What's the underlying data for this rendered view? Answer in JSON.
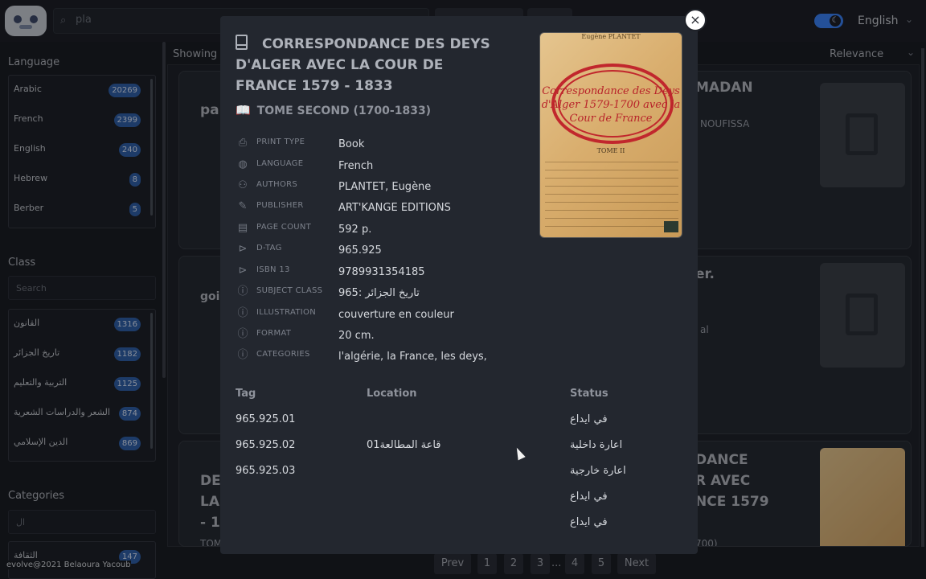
{
  "topbar": {
    "search_value": "pla",
    "language": "English"
  },
  "sidebar": {
    "language_title": "Language",
    "languages": [
      {
        "label": "Arabic",
        "count": "20269"
      },
      {
        "label": "French",
        "count": "2399"
      },
      {
        "label": "English",
        "count": "240"
      },
      {
        "label": "Hebrew",
        "count": "8"
      },
      {
        "label": "Berber",
        "count": "5"
      }
    ],
    "class_title": "Class",
    "class_search_placeholder": "Search",
    "classes": [
      {
        "label": "القانون",
        "count": "1316"
      },
      {
        "label": "تاريخ الجزائر",
        "count": "1182"
      },
      {
        "label": "التربية والتعليم",
        "count": "1125"
      },
      {
        "label": "الشعر والدراسات الشعرية",
        "count": "874"
      },
      {
        "label": "الدين الإسلامي",
        "count": "869"
      }
    ],
    "categories_title": "Categories",
    "categories_search_value": "ال",
    "categories": [
      {
        "label": "الثقافة",
        "count": "147"
      }
    ]
  },
  "footer": "evolve@2021 Belaoura Yacoub",
  "main": {
    "showing": "Showing",
    "sort": "Relevance",
    "cards": [
      {
        "title_fragment": "pa",
        "side_title": "MADAN",
        "side_sub": "NOUFISSA"
      },
      {
        "title_fragment": "goi",
        "side_title": "er.",
        "side_sub": "al"
      },
      {
        "title_fragment": "DE\nLA\n- 18",
        "side_title": "DANCE\nR AVEC\nNCE 1579",
        "side_sub": "700)",
        "sub_fragment": "TOM"
      }
    ]
  },
  "pager": {
    "prev": "Prev",
    "pages": [
      "1",
      "2",
      "3",
      "4",
      "5"
    ],
    "ellipsis": "...",
    "next": "Next"
  },
  "modal": {
    "title": "CORRESPONDANCE DES DEYS D'ALGER AVEC LA COUR DE FRANCE 1579 - 1833",
    "subtitle": "TOME SECOND (1700-1833)",
    "properties": [
      {
        "icon": "printer-icon",
        "label": "PRINT TYPE",
        "value": "Book"
      },
      {
        "icon": "globe-icon",
        "label": "LANGUAGE",
        "value": "French"
      },
      {
        "icon": "users-icon",
        "label": "AUTHORS",
        "value": "PLANTET, Eugène"
      },
      {
        "icon": "feather-icon",
        "label": "PUBLISHER",
        "value": "ART'KANGE EDITIONS"
      },
      {
        "icon": "document-icon",
        "label": "PAGE COUNT",
        "value": "592 p."
      },
      {
        "icon": "tag-icon",
        "label": "D-TAG",
        "value": "965.925"
      },
      {
        "icon": "tag-icon",
        "label": "ISBN 13",
        "value": "9789931354185"
      },
      {
        "icon": "info-icon",
        "label": "SUBJECT CLASS",
        "value": "965: تاريخ الجزائر"
      },
      {
        "icon": "info-icon",
        "label": "ILLUSTRATION",
        "value": "couverture en couleur"
      },
      {
        "icon": "info-icon",
        "label": "FORMAT",
        "value": "20 cm."
      },
      {
        "icon": "info-icon",
        "label": "CATEGORIES",
        "value": "l'algérie, la France, les deys,"
      }
    ],
    "cover": {
      "author": "Eugène PLANTET",
      "title": "Correspondance des Deys d'Alger 1579-1700 avec la Cour de France",
      "tome": "TOME II"
    },
    "items_headers": {
      "tag": "Tag",
      "location": "Location",
      "status": "Status"
    },
    "items": [
      {
        "tag": "965.925.01",
        "location": "",
        "status": "في ايداع"
      },
      {
        "tag": "965.925.02",
        "location": "قاعة المطالعة01",
        "status": "اعارة داخلية"
      },
      {
        "tag": "965.925.03",
        "location": "",
        "status": "اعارة خارجية"
      },
      {
        "tag": "",
        "location": "",
        "status": "في ايداع"
      },
      {
        "tag": "",
        "location": "",
        "status": "في ايداع"
      }
    ],
    "close_symbol": "×"
  },
  "colors": {
    "accent": "#3b82f6",
    "badge": "#2f5fa8",
    "seal": "#c1272d"
  }
}
